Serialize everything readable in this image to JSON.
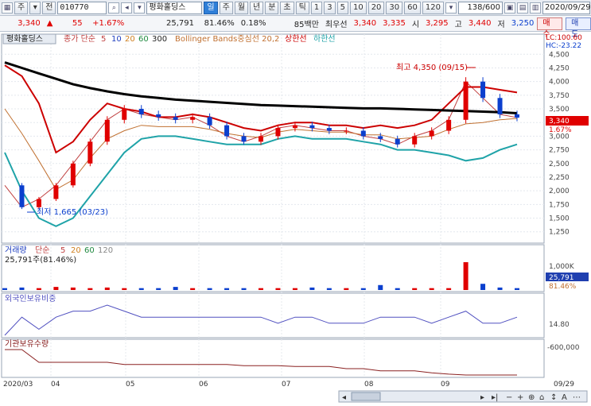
{
  "toolbar": {
    "mode_label": "주",
    "code": "010770",
    "name": "평화홀딩스",
    "period_buttons": [
      "일",
      "주",
      "월",
      "년",
      "분",
      "초",
      "틱"
    ],
    "period_selected": "일",
    "interval_buttons": [
      "1",
      "3",
      "5",
      "10",
      "20",
      "30",
      "60",
      "120"
    ],
    "count_value": "138/600",
    "date_value": "2020/09/29",
    "buy_label": "매수",
    "sell_label": "매도"
  },
  "quote": {
    "price": "3,340",
    "change": "55",
    "change_pct": "+1.67%",
    "volume": "25,791",
    "vol_ratio": "81.46%",
    "turnover": "0.18%",
    "amount": "85백만",
    "best_ask_label": "최우선",
    "best_ask_1": "3,340",
    "best_ask_2": "3,335",
    "open_label": "시",
    "open": "3,295",
    "high_label": "고",
    "high": "3,440",
    "low_label": "저",
    "low": "3,250"
  },
  "legend": {
    "stock": "평화홀딩스",
    "ma_label": "종가 단순",
    "ma_periods": [
      "5",
      "10",
      "20",
      "60",
      "300"
    ],
    "bollinger": "Bollinger Bands중심선 20,2",
    "upper": "상한선",
    "lower": "하한선"
  },
  "annotations": {
    "high_note": "최고 4,350 (09/15)",
    "low_note": "최저 1,665 (03/23)",
    "lc_hc": "LC:100.60",
    "hc_val": "HC:-23.22",
    "current_tag": "3,340",
    "current_pct": "1.67%"
  },
  "volume_panel": {
    "title": "거래량",
    "ma_label": "단순",
    "ma_periods": [
      "5",
      "20",
      "60",
      "120"
    ],
    "current": "25,791주(81.46%)",
    "axis_tick": "1,000K",
    "current_tag": "25,791",
    "pct_tag": "81.46%"
  },
  "foreign_panel": {
    "title": "외국인보유비중",
    "axis_tick": "14.80"
  },
  "inst_panel": {
    "title": "기관보유수량",
    "axis_tick": "-600,000"
  },
  "x_axis": {
    "labels": [
      "2020/03",
      "04",
      "05",
      "06",
      "07",
      "08",
      "09",
      "09/29"
    ]
  },
  "chart_data": {
    "type": "line",
    "title": "",
    "y_ticks": [
      "4,500",
      "4,250",
      "4,000",
      "3,750",
      "3,500",
      "3,250",
      "3,000",
      "2,750",
      "2,500",
      "2,250",
      "2,000",
      "1,750",
      "1,500",
      "1,250"
    ],
    "ylim": [
      1100,
      4650
    ],
    "series": [
      {
        "name": "종가",
        "values": [
          2100,
          1700,
          1850,
          2100,
          2500,
          2900,
          3300,
          3500,
          3400,
          3350,
          3300,
          3350,
          3200,
          3000,
          2900,
          3000,
          3150,
          3200,
          3150,
          3100,
          3100,
          3000,
          2950,
          2850,
          3000,
          3100,
          3300,
          4000,
          3700,
          3400,
          3340
        ]
      },
      {
        "name": "상한선",
        "values": [
          4300,
          4100,
          3600,
          2700,
          2900,
          3300,
          3600,
          3500,
          3450,
          3350,
          3350,
          3400,
          3350,
          3250,
          3150,
          3100,
          3200,
          3250,
          3250,
          3200,
          3200,
          3150,
          3200,
          3150,
          3200,
          3300,
          3600,
          3900,
          3900,
          3850,
          3800
        ]
      },
      {
        "name": "하한선",
        "values": [
          2700,
          2000,
          1500,
          1350,
          1500,
          1900,
          2300,
          2700,
          2950,
          3000,
          3000,
          2950,
          2900,
          2850,
          2850,
          2850,
          2950,
          3000,
          2950,
          2950,
          2950,
          2900,
          2850,
          2750,
          2750,
          2700,
          2650,
          2550,
          2600,
          2750,
          2850
        ]
      },
      {
        "name": "300",
        "values": [
          4350,
          4250,
          4150,
          4050,
          3950,
          3880,
          3820,
          3770,
          3730,
          3700,
          3670,
          3650,
          3630,
          3610,
          3590,
          3570,
          3560,
          3550,
          3540,
          3530,
          3520,
          3510,
          3510,
          3500,
          3490,
          3480,
          3470,
          3460,
          3450,
          3440,
          3420
        ]
      }
    ],
    "volume_values": [
      3,
      4,
      3,
      5,
      4,
      3,
      4,
      3,
      3,
      3,
      5,
      3,
      3,
      3,
      3,
      3,
      3,
      3,
      4,
      3,
      3,
      3,
      8,
      3,
      3,
      3,
      3,
      45,
      10,
      4,
      3
    ],
    "foreign_values": [
      14.6,
      14.9,
      14.7,
      14.9,
      15.0,
      15.0,
      15.1,
      15.0,
      14.9,
      14.9,
      14.9,
      14.9,
      14.9,
      14.9,
      14.9,
      14.9,
      14.8,
      14.9,
      14.9,
      14.8,
      14.8,
      14.8,
      14.9,
      14.9,
      14.9,
      14.8,
      14.9,
      15.0,
      14.8,
      14.8,
      14.9
    ],
    "inst_values": [
      -560000,
      -560000,
      -590000,
      -590000,
      -590000,
      -590000,
      -590000,
      -595000,
      -595000,
      -595000,
      -595000,
      -595000,
      -595000,
      -595000,
      -598000,
      -598000,
      -598000,
      -600000,
      -600000,
      -600000,
      -605000,
      -605000,
      -610000,
      -610000,
      -610000,
      -615000,
      -618000,
      -620000,
      -620000,
      -620000,
      -620000
    ]
  },
  "colors": {
    "up": "#e00000",
    "down": "#0b3fce",
    "ma300": "#000000",
    "upper": "#cc0000",
    "lower": "#1fa3a8",
    "mid": "#c07030"
  }
}
